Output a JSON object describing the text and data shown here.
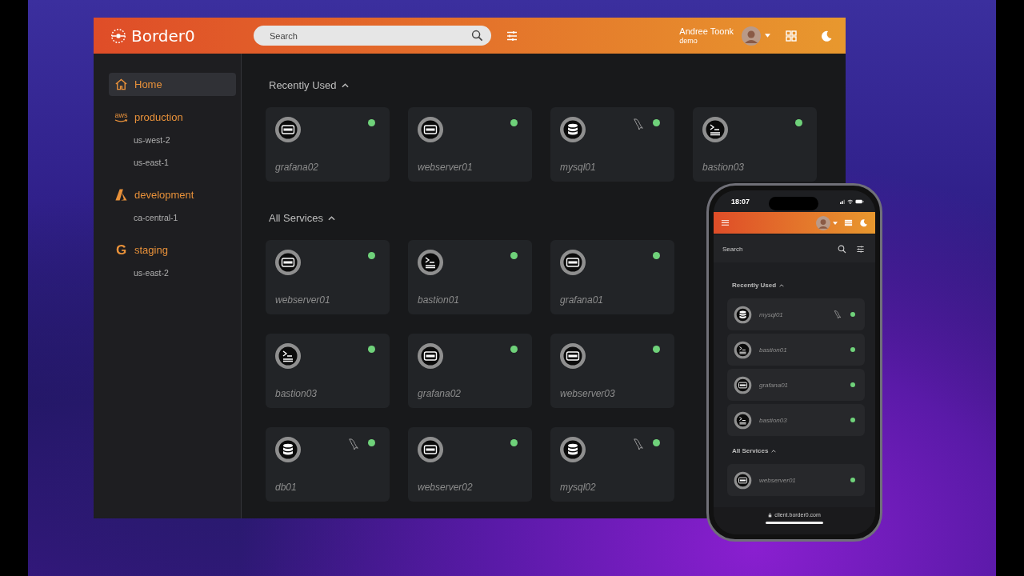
{
  "app": {
    "logo": "Border0",
    "search": {
      "placeholder": "Search"
    },
    "user": {
      "name": "Andree Toonk",
      "org": "demo"
    }
  },
  "sidebar": {
    "items": [
      {
        "label": "Home",
        "kind": "home",
        "selected": true
      },
      {
        "label": "production",
        "kind": "aws",
        "logo_text": "aws",
        "selected": false,
        "regions": [
          "us-west-2",
          "us-east-1"
        ]
      },
      {
        "label": "development",
        "kind": "azure",
        "selected": false,
        "regions": [
          "ca-central-1"
        ]
      },
      {
        "label": "staging",
        "kind": "gcp",
        "logo_text": "G",
        "selected": false,
        "regions": [
          "us-east-2"
        ]
      }
    ]
  },
  "sections": [
    {
      "title": "Recently Used",
      "expanded": true,
      "services": [
        {
          "name": "grafana02",
          "kind": "https",
          "mysql": false,
          "online": true
        },
        {
          "name": "webserver01",
          "kind": "https",
          "mysql": false,
          "online": true
        },
        {
          "name": "mysql01",
          "kind": "database",
          "mysql": true,
          "online": true
        },
        {
          "name": "bastion03",
          "kind": "ssh",
          "mysql": false,
          "online": true
        }
      ]
    },
    {
      "title": "All Services",
      "expanded": true,
      "services": [
        {
          "name": "webserver01",
          "kind": "https",
          "mysql": false,
          "online": true
        },
        {
          "name": "bastion01",
          "kind": "ssh",
          "mysql": false,
          "online": true
        },
        {
          "name": "grafana01",
          "kind": "https",
          "mysql": false,
          "online": true
        },
        {
          "name": "bastion03",
          "kind": "ssh",
          "mysql": false,
          "online": true
        },
        {
          "name": "grafana02",
          "kind": "https",
          "mysql": false,
          "online": true
        },
        {
          "name": "webserver03",
          "kind": "https",
          "mysql": false,
          "online": true
        },
        {
          "name": "db01",
          "kind": "database",
          "mysql": true,
          "online": true
        },
        {
          "name": "webserver02",
          "kind": "https",
          "mysql": false,
          "online": true
        },
        {
          "name": "mysql02",
          "kind": "database",
          "mysql": true,
          "online": true
        }
      ]
    }
  ],
  "phone": {
    "time": "18:07",
    "search": {
      "placeholder": "Search"
    },
    "sections": [
      {
        "title": "Recently Used",
        "expanded": true,
        "services": [
          {
            "name": "mysql01",
            "kind": "database",
            "mysql": true,
            "online": true
          },
          {
            "name": "bastion01",
            "kind": "ssh",
            "mysql": false,
            "online": true
          },
          {
            "name": "grafana01",
            "kind": "https",
            "mysql": false,
            "online": true
          },
          {
            "name": "bastion03",
            "kind": "ssh",
            "mysql": false,
            "online": true
          }
        ]
      },
      {
        "title": "All Services",
        "expanded": true,
        "services": [
          {
            "name": "webserver01",
            "kind": "https",
            "mysql": false,
            "online": true
          }
        ]
      }
    ],
    "url": "client.border0.com"
  }
}
